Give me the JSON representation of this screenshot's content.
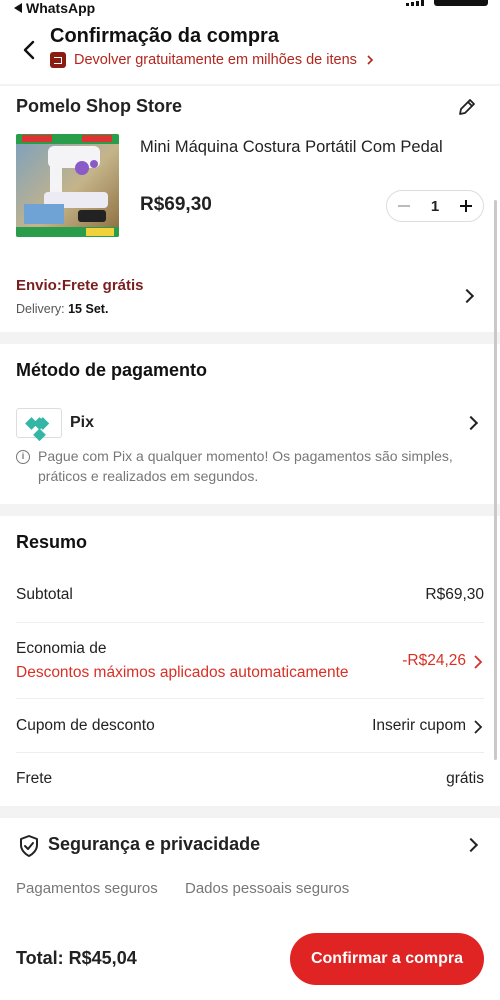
{
  "status_bar": {
    "back_app": "WhatsApp"
  },
  "header": {
    "title": "Confirmação da compra",
    "return_policy": "Devolver gratuitamente em milhões de itens"
  },
  "store": {
    "name": "Pomelo Shop Store",
    "product": {
      "title": "Mini Máquina Costura Portátil Com Pedal",
      "price": "R$69,30",
      "quantity": "1"
    },
    "shipping": {
      "title": "Envio:Frete grátis",
      "delivery_label": "Delivery:",
      "delivery_date": "15 Set."
    }
  },
  "payment": {
    "section_title": "Método de pagamento",
    "method": "Pix",
    "info": "Pague com Pix a qualquer momento! Os pagamentos são simples, práticos e realizados em segundos."
  },
  "summary": {
    "section_title": "Resumo",
    "subtotal_label": "Subtotal",
    "subtotal_value": "R$69,30",
    "savings_label": "Economia de",
    "savings_detail": "Descontos máximos aplicados automaticamente",
    "savings_value": "-R$24,26",
    "coupon_label": "Cupom de desconto",
    "coupon_action": "Inserir cupom",
    "shipping_label": "Frete",
    "shipping_value": "grátis"
  },
  "security": {
    "title": "Segurança e privacidade",
    "tags": [
      "Pagamentos seguros",
      "Dados pessoais seguros"
    ]
  },
  "footer": {
    "total_label": "Total: R$45,04",
    "confirm_label": "Confirmar a compra"
  },
  "colors": {
    "accent_red": "#e02424",
    "discount_red": "#d93025",
    "shipping_title": "#7a1f1f",
    "pix_green": "#34b6a6"
  }
}
